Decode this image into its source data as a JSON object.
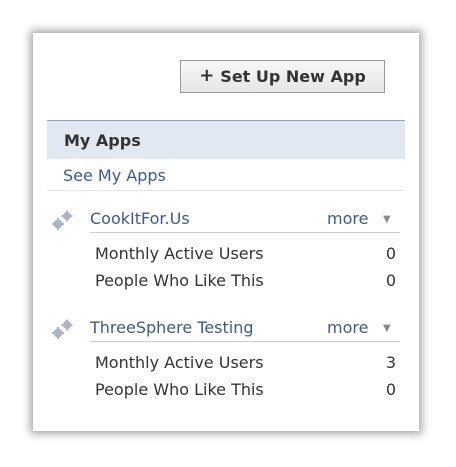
{
  "toolbar": {
    "setup_label": "Set Up New App",
    "plus_icon": "plus-icon"
  },
  "section": {
    "title": "My Apps",
    "see_link": "See My Apps"
  },
  "apps": [
    {
      "name": "CookItFor.Us",
      "more": "more",
      "stats": [
        {
          "label": "Monthly Active Users",
          "value": "0"
        },
        {
          "label": "People Who Like This",
          "value": "0"
        }
      ]
    },
    {
      "name": "ThreeSphere Testing",
      "more": "more",
      "stats": [
        {
          "label": "Monthly Active Users",
          "value": "3"
        },
        {
          "label": "People Who Like This",
          "value": "0"
        }
      ]
    }
  ],
  "colors": {
    "link": "#3b5998",
    "header_bg": "#e2e8f2",
    "text": "#333333"
  }
}
